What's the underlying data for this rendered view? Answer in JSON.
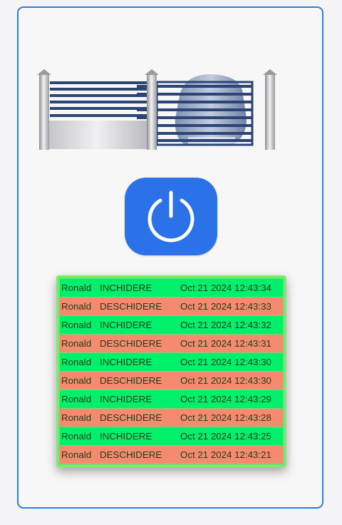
{
  "colors": {
    "frame": "#2f7de1",
    "power_button": "#2b72e9",
    "close_row": "#00f06c",
    "open_row": "#f48a6e",
    "log_border": "#7df060"
  },
  "gate_image": {
    "icon": "sliding-gate-icon"
  },
  "power_button": {
    "icon": "power-icon"
  },
  "log": [
    {
      "user": "Ronald",
      "action": "INCHIDERE",
      "time": "Oct 21 2024 12:43:34",
      "type": "close"
    },
    {
      "user": "Ronald",
      "action": "DESCHIDERE",
      "time": "Oct 21 2024 12:43:33",
      "type": "open"
    },
    {
      "user": "Ronald",
      "action": "INCHIDERE",
      "time": "Oct 21 2024 12:43:32",
      "type": "close"
    },
    {
      "user": "Ronald",
      "action": "DESCHIDERE",
      "time": "Oct 21 2024 12:43:31",
      "type": "open"
    },
    {
      "user": "Ronald",
      "action": "INCHIDERE",
      "time": "Oct 21 2024 12:43:30",
      "type": "close"
    },
    {
      "user": "Ronald",
      "action": "DESCHIDERE",
      "time": "Oct 21 2024 12:43:30",
      "type": "open"
    },
    {
      "user": "Ronald",
      "action": "INCHIDERE",
      "time": "Oct 21 2024 12:43:29",
      "type": "close"
    },
    {
      "user": "Ronald",
      "action": "DESCHIDERE",
      "time": "Oct 21 2024 12:43:28",
      "type": "open"
    },
    {
      "user": "Ronald",
      "action": "INCHIDERE",
      "time": "Oct 21 2024 12:43:25",
      "type": "close"
    },
    {
      "user": "Ronald",
      "action": "DESCHIDERE",
      "time": "Oct 21 2024 12:43:21",
      "type": "open"
    }
  ]
}
